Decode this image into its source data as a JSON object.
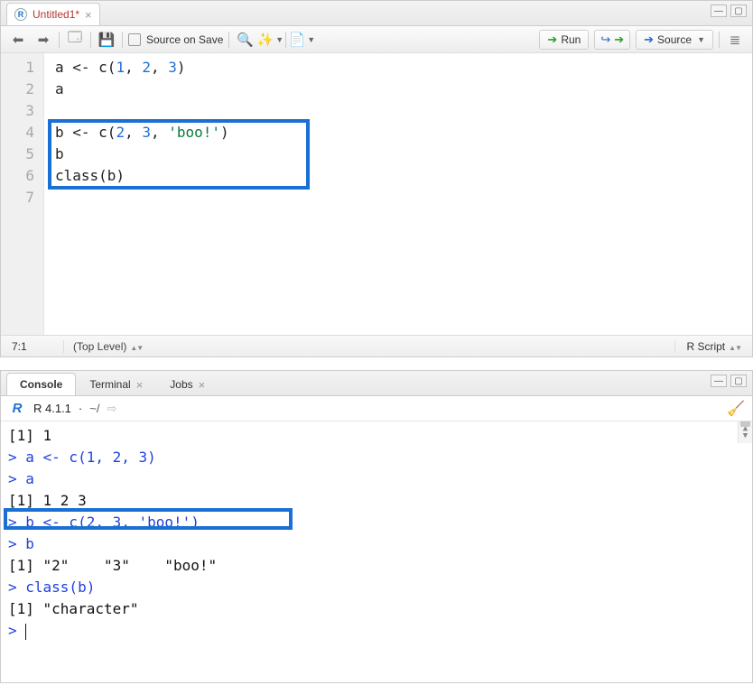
{
  "editor": {
    "tab": {
      "icon_text": "R",
      "title": "Untitled1*",
      "close": "×"
    },
    "toolbar": {
      "source_on_save": "Source on Save",
      "run": "Run",
      "source": "Source"
    },
    "lines": [
      {
        "n": "1",
        "tokens": [
          {
            "t": "a <- c(",
            "c": "tok-kw"
          },
          {
            "t": "1",
            "c": "tok-num"
          },
          {
            "t": ", ",
            "c": "tok-kw"
          },
          {
            "t": "2",
            "c": "tok-num"
          },
          {
            "t": ", ",
            "c": "tok-kw"
          },
          {
            "t": "3",
            "c": "tok-num"
          },
          {
            "t": ")",
            "c": "tok-kw"
          }
        ]
      },
      {
        "n": "2",
        "tokens": [
          {
            "t": "a",
            "c": "tok-kw"
          }
        ]
      },
      {
        "n": "3",
        "tokens": []
      },
      {
        "n": "4",
        "tokens": [
          {
            "t": "b <- c(",
            "c": "tok-kw"
          },
          {
            "t": "2",
            "c": "tok-num"
          },
          {
            "t": ", ",
            "c": "tok-kw"
          },
          {
            "t": "3",
            "c": "tok-num"
          },
          {
            "t": ", ",
            "c": "tok-kw"
          },
          {
            "t": "'boo!'",
            "c": "tok-str"
          },
          {
            "t": ")",
            "c": "tok-kw"
          }
        ]
      },
      {
        "n": "5",
        "tokens": [
          {
            "t": "b",
            "c": "tok-kw"
          }
        ]
      },
      {
        "n": "6",
        "tokens": [
          {
            "t": "class(b)",
            "c": "tok-kw"
          }
        ]
      },
      {
        "n": "7",
        "tokens": []
      }
    ],
    "status": {
      "pos": "7:1",
      "scope": "(Top Level)",
      "lang": "R Script"
    }
  },
  "console": {
    "tabs": {
      "console": "Console",
      "terminal": "Terminal",
      "jobs": "Jobs",
      "close": "×"
    },
    "header": {
      "logo": "R",
      "version": "R 4.1.1",
      "dot": "·",
      "path": "~/"
    },
    "lines": [
      {
        "cls": "outline",
        "t": "[1] 1"
      },
      {
        "cls": "cmdline",
        "t": "> a <- c(1, 2, 3)"
      },
      {
        "cls": "cmdline",
        "t": "> a"
      },
      {
        "cls": "outline",
        "t": "[1] 1 2 3"
      },
      {
        "cls": "cmdline",
        "t": "> b <- c(2, 3, 'boo!')"
      },
      {
        "cls": "cmdline",
        "t": "> b"
      },
      {
        "cls": "outline",
        "t": "[1] \"2\"    \"3\"    \"boo!\""
      },
      {
        "cls": "cmdline",
        "t": "> class(b)"
      },
      {
        "cls": "outline",
        "t": "[1] \"character\""
      }
    ],
    "prompt": ">"
  }
}
